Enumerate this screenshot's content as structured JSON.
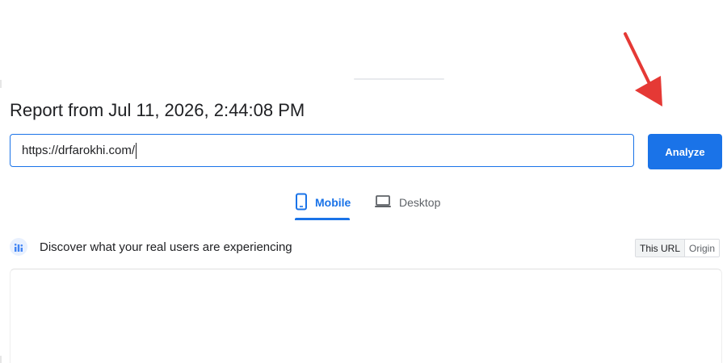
{
  "report": {
    "title": "Report from Jul 11, 2026, 2:44:08 PM"
  },
  "search": {
    "value": "https://drfarokhi.com/",
    "button_label": "Analyze"
  },
  "tabs": [
    {
      "label": "Mobile",
      "icon": "phone-icon",
      "active": true
    },
    {
      "label": "Desktop",
      "icon": "laptop-icon",
      "active": false
    }
  ],
  "crux": {
    "title": "Discover what your real users are experiencing",
    "icon": "crux-users-icon",
    "toggle": [
      {
        "label": "This URL",
        "active": true
      },
      {
        "label": "Origin",
        "active": false
      }
    ]
  },
  "colors": {
    "accent": "#1a73e8",
    "annotation_arrow": "#e53935"
  }
}
